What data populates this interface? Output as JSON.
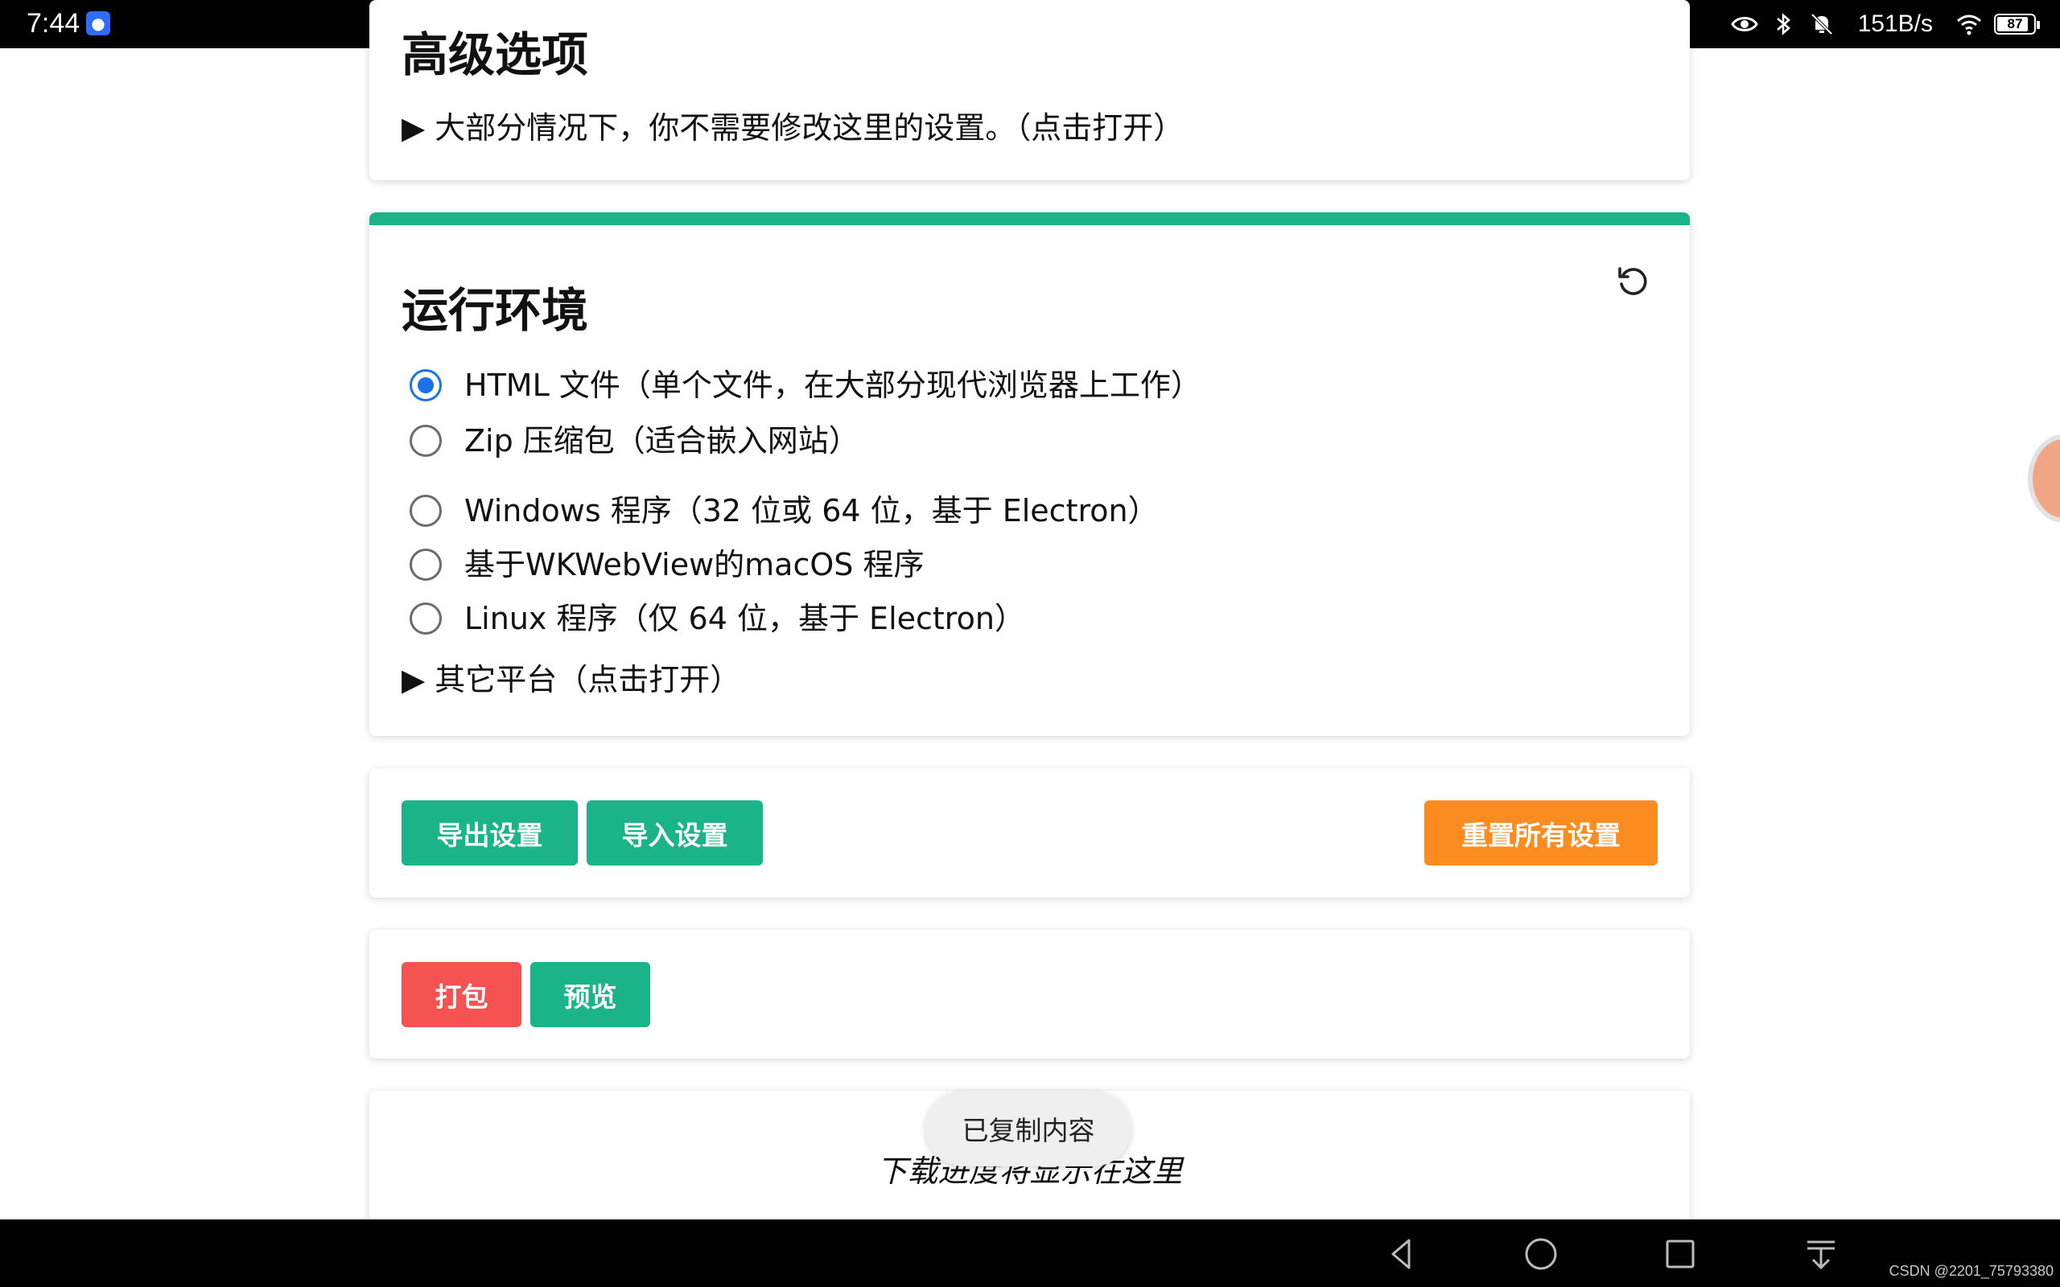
{
  "status_bar": {
    "time": "7:44",
    "app_icon": "baidu-paw-icon",
    "net_speed": "151B/s",
    "battery": "87",
    "icons": [
      "eye-icon",
      "bluetooth-icon",
      "mute-bell-icon",
      "wifi-icon",
      "battery-icon"
    ]
  },
  "advanced": {
    "title": "高级选项",
    "summary": "▶ 大部分情况下，你不需要修改这里的设置。（点击打开）"
  },
  "environment": {
    "title": "运行环境",
    "reset_icon": "restore-icon",
    "accent_color": "#1bb488",
    "options": [
      {
        "label": "HTML 文件（单个文件，在大部分现代浏览器上工作）",
        "checked": true
      },
      {
        "label": "Zip 压缩包（适合嵌入网站）",
        "checked": false
      },
      {
        "label": "Windows 程序（32 位或 64 位，基于 Electron）",
        "checked": false
      },
      {
        "label": "基于WKWebView的macOS 程序",
        "checked": false
      },
      {
        "label": "Linux 程序（仅 64 位，基于 Electron）",
        "checked": false
      }
    ],
    "other_platforms": "▶ 其它平台（点击打开）"
  },
  "settings_actions": {
    "export_label": "导出设置",
    "import_label": "导入设置",
    "reset_all_label": "重置所有设置"
  },
  "package_actions": {
    "package_label": "打包",
    "preview_label": "预览"
  },
  "progress": {
    "placeholder": "下载进度将显示在这里"
  },
  "toast": {
    "message": "已复制内容"
  },
  "nav_bar": {
    "buttons": [
      "back-icon",
      "home-icon",
      "recents-icon",
      "download-icon"
    ],
    "watermark": "CSDN @2201_75793380"
  },
  "colors": {
    "green": "#1bb488",
    "red": "#f55252",
    "orange": "#fb8c1f",
    "radio_selected": "#1a73e8"
  }
}
